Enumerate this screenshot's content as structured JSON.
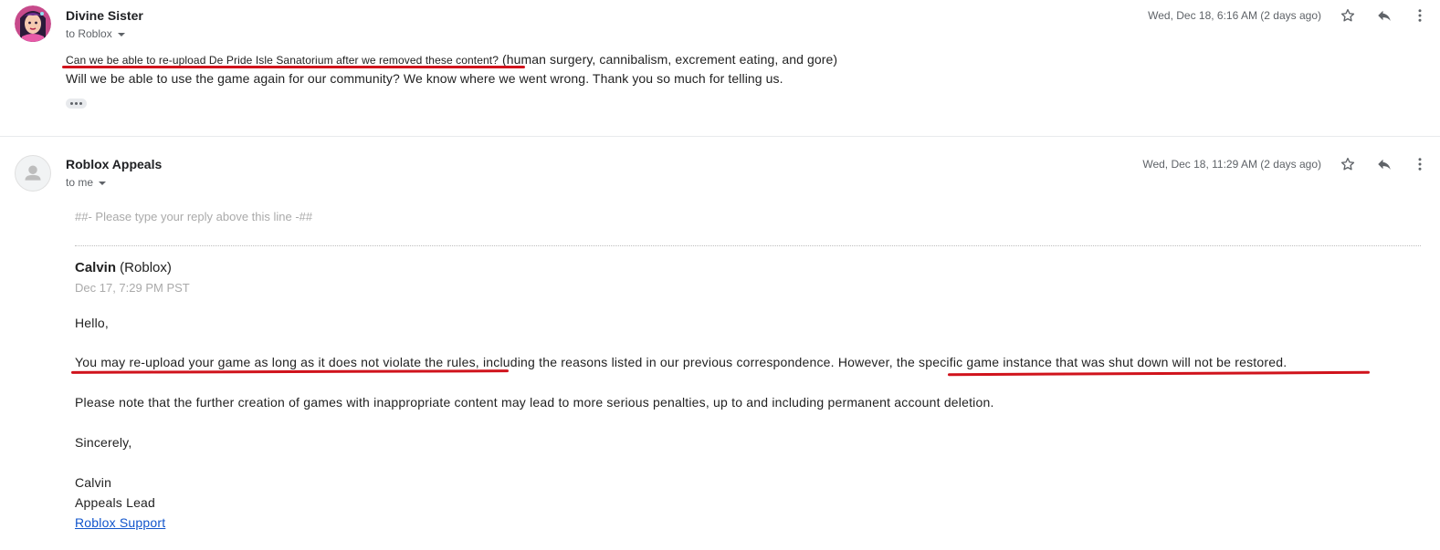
{
  "messages": [
    {
      "sender": "Divine Sister",
      "to": "to Roblox",
      "date": "Wed, Dec 18, 6:16 AM (2 days ago)",
      "body_highlight": "Can we be able to re-upload De Pride Isle Sanatorium after we removed these content?",
      "body_rest": " (human surgery, cannibalism, excrement eating, and gore)",
      "body_line2": "Will we be able to use the game again for our community? We know where we went wrong. Thank you so much for telling us."
    },
    {
      "sender": "Roblox Appeals",
      "to": "to me",
      "date": "Wed, Dec 18, 11:29 AM (2 days ago)",
      "quote_marker": "##- Please type your reply above this line -##",
      "agent_name": "Calvin",
      "agent_org": " (Roblox)",
      "agent_date": "Dec 17, 7:29 PM PST",
      "greeting": "Hello,",
      "para_part1": "You may re-upload your game as long as it does not violate the rules,",
      "para_part2": " including the reasons listed in our previous correspondence. However, ",
      "para_part3": "the specific game instance that was shut down will not be restored.",
      "para_note": "Please note that the further creation of games with inappropriate content may lead to more serious penalties, up to and including permanent account deletion.",
      "closing": "Sincerely,",
      "sig_name": "Calvin",
      "sig_title": "Appeals Lead",
      "sig_link": "Roblox Support"
    }
  ],
  "icons": [
    "star-icon",
    "reply-icon",
    "more-vert-icon",
    "caret-down-icon",
    "person-icon"
  ],
  "colors": {
    "underline": "#d0131c",
    "link": "#1155cc",
    "muted": "#5f6368"
  }
}
